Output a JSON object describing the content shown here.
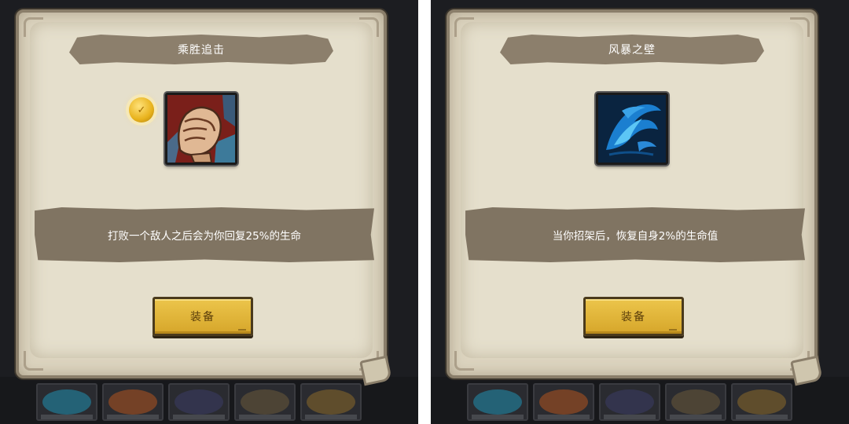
{
  "panels": [
    {
      "title": "乘胜追击",
      "description": "打败一个敌人之后会为你回复25%的生命",
      "button_label": "装备",
      "skill_icon": "fist-icon",
      "has_coin": true
    },
    {
      "title": "风暴之壁",
      "description": "当你招架后，恢复自身2%的生命值",
      "button_label": "装备",
      "skill_icon": "storm-wall-icon",
      "has_coin": false
    }
  ],
  "colors": {
    "parchment": "#e5dfcc",
    "banner": "#8c7f6c",
    "button": "#e2b73c"
  }
}
